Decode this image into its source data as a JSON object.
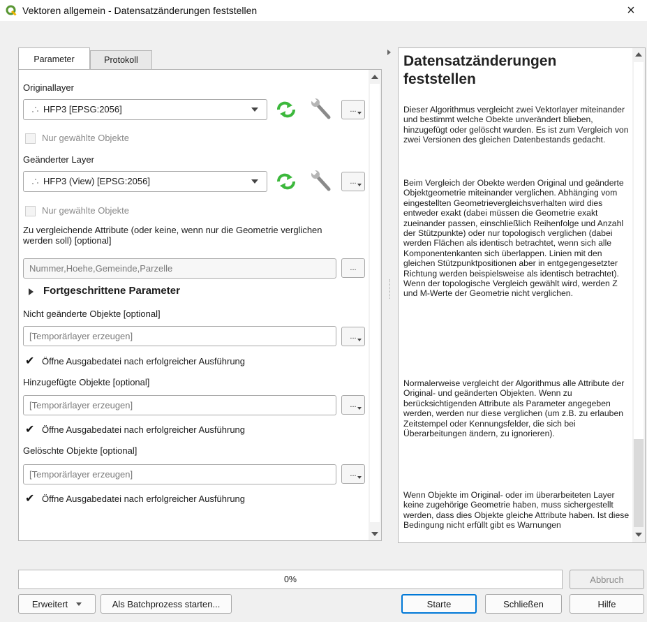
{
  "window": {
    "title": "Vektoren allgemein - Datensatzänderungen feststellen",
    "close": "×"
  },
  "tabs": [
    {
      "label": "Parameter"
    },
    {
      "label": "Protokoll"
    }
  ],
  "params": {
    "original_layer_label": "Originallayer",
    "original_layer_value": "HFP3 [EPSG:2056]",
    "original_selected_only": "Nur gewählte Objekte",
    "changed_layer_label": "Geänderter Layer",
    "changed_layer_value": "HFP3 (View) [EPSG:2056]",
    "changed_selected_only": "Nur gewählte Objekte",
    "attributes_label": "Zu vergleichende Attribute (oder keine, wenn nur die Geometrie verglichen werden soll) [optional]",
    "attributes_value": "Nummer,Hoehe,Gemeinde,Parzelle",
    "advanced_label": "Fortgeschrittene Parameter",
    "unchanged_label": "Nicht geänderte Objekte [optional]",
    "unchanged_value": "[Temporärlayer erzeugen]",
    "unchanged_open": "Öffne Ausgabedatei nach erfolgreicher Ausführung",
    "added_label": "Hinzugefügte Objekte [optional]",
    "added_value": "[Temporärlayer erzeugen]",
    "added_open": "Öffne Ausgabedatei nach erfolgreicher Ausführung",
    "deleted_label": "Gelöschte Objekte [optional]",
    "deleted_value": "[Temporärlayer erzeugen]",
    "deleted_open": "Öffne Ausgabedatei nach erfolgreicher Ausführung",
    "dots": "..."
  },
  "help": {
    "heading": "Datensatzänderungen feststellen",
    "paragraphs": [
      "Dieser Algorithmus vergleicht zwei Vektorlayer miteinander und bestimmt welche Obekte unverändert blieben, hinzugefügt oder gelöscht wurden. Es ist zum Vergleich von zwei Versionen des gleichen Datenbestands gedacht.",
      "Beim Vergleich der Obekte werden Original und geänderte Objektgeometrie miteinander verglichen. Abhänging vom eingestellten Geometrievergleichsverhalten wird dies entweder exakt (dabei müssen die Geometrie exakt zueinander passen, einschließlich Reihenfolge und Anzahl der Stützpunkte) oder nur topologisch verglichen (dabei werden Flächen als identisch betrachtet, wenn sich alle Komponentenkanten sich überlappen. Linien mit den gleichen Stützpunktpositionen aber in entgegengesetzter Richtung werden beispielsweise als identisch betrachtet). Wenn der topologische Vergleich gewählt wird, werden Z und M-Werte der Geometrie nicht verglichen.",
      "Normalerweise vergleicht der Algorithmus alle Attribute der Original- und geänderten Objekten. Wenn zu berücksichtigenden Attribute als Parameter angegeben werden, werden nur diese verglichen (um z.B. zu erlauben Zeitstempel oder Kennungsfelder, die sich bei Überarbeitungen ändern, zu ignorieren).",
      "Wenn Objekte im Original- oder im überarbeiteten Layer keine zugehörige Geometrie haben, muss sichergestellt werden, dass dies Objekte gleiche Attribute haben. Ist diese Bedingung nicht erfüllt gibt es Warnungen"
    ]
  },
  "progress": {
    "value": 0,
    "text": "0%"
  },
  "buttons": {
    "cancel": "Abbruch",
    "advanced": "Erweitert",
    "batch": "Als Batchprozess starten...",
    "run": "Starte",
    "close": "Schließen",
    "help": "Hilfe"
  },
  "colors": {
    "qgis_green": "#589632",
    "refresh_green": "#3cb83c",
    "accent": "#0078d7"
  }
}
